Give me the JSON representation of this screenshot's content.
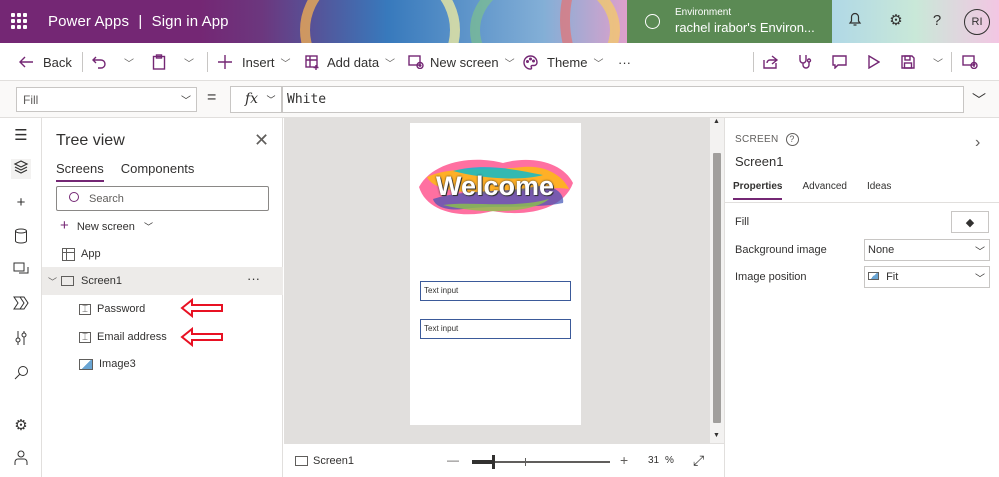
{
  "app": {
    "title": "Power Apps",
    "separator": "|",
    "doc_name": "Sign in App"
  },
  "environment": {
    "label": "Environment",
    "value": "rachel irabor's Environ..."
  },
  "user": {
    "initials": "RI"
  },
  "commands": {
    "back": "Back",
    "insert": "Insert",
    "add_data": "Add data",
    "new_screen": "New screen",
    "theme": "Theme",
    "more": "···"
  },
  "formula": {
    "property": "Fill",
    "equals": "=",
    "fx": "fx",
    "value": "White"
  },
  "tree": {
    "title": "Tree view",
    "tabs": [
      "Screens",
      "Components"
    ],
    "search_placeholder": "Search",
    "new_screen": "New screen",
    "nodes": {
      "app": "App",
      "screen1": "Screen1",
      "password": "Password",
      "email": "Email address",
      "image": "Image3"
    },
    "more": "···"
  },
  "canvas": {
    "welcome_text": "Welcome",
    "inputs": [
      "Text input",
      "Text input"
    ]
  },
  "status": {
    "screen": "Screen1",
    "zoom_value": "31",
    "zoom_unit": "%",
    "minus": "—",
    "plus": "+"
  },
  "properties": {
    "caption": "SCREEN",
    "name": "Screen1",
    "tabs": [
      "Properties",
      "Advanced",
      "Ideas"
    ],
    "fill_label": "Fill",
    "bg_label": "Background image",
    "bg_value": "None",
    "pos_label": "Image position",
    "pos_value": "Fit"
  },
  "colors": {
    "brand": "#742774",
    "annotation_arrow": "#e81123",
    "input_border": "#3b5a9a"
  },
  "zoom_slider": {
    "fraction": 0.15
  }
}
